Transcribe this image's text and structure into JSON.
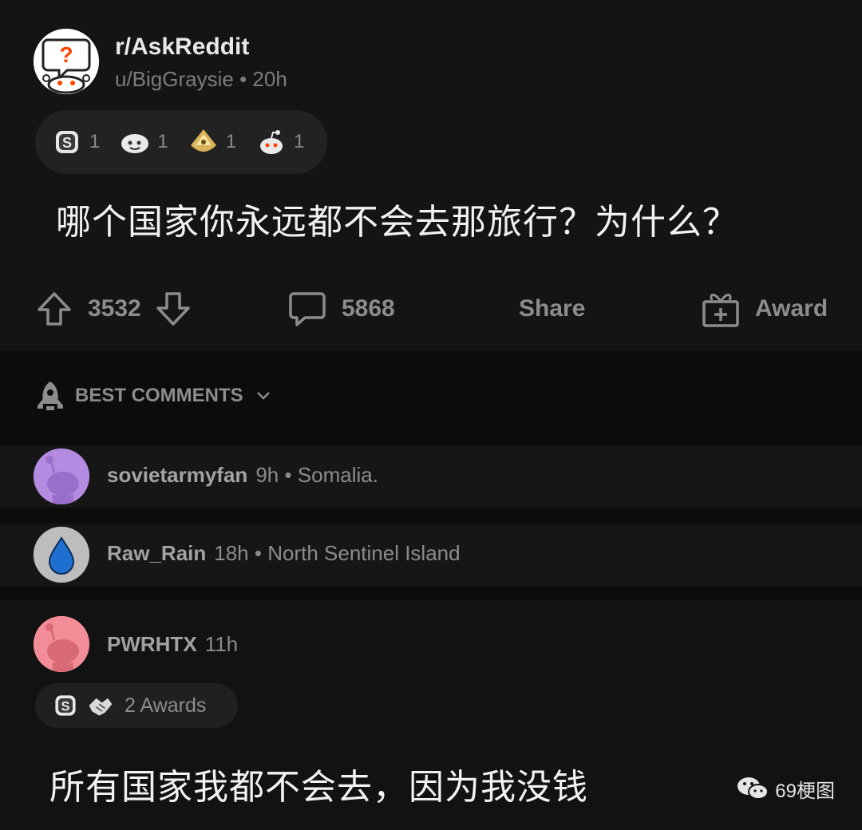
{
  "post": {
    "subreddit": "r/AskReddit",
    "author": "u/BigGraysie",
    "separator": " • ",
    "age": "20h",
    "awards": [
      {
        "icon": "silver-award-icon",
        "count": "1"
      },
      {
        "icon": "wholesome-award-icon",
        "count": "1"
      },
      {
        "icon": "helpful-award-icon",
        "count": "1"
      },
      {
        "icon": "snoo-award-icon",
        "count": "1"
      }
    ],
    "title": "哪个国家你永远都不会去那旅行？为什么？",
    "score": "3532",
    "comment_count": "5868",
    "share_label": "Share",
    "award_label": "Award"
  },
  "sort": {
    "label": "BEST COMMENTS"
  },
  "comments": [
    {
      "user": "sovietarmyfan",
      "age": "9h",
      "separator": " • ",
      "text": "Somalia."
    },
    {
      "user": "Raw_Rain",
      "age": "18h",
      "separator": " • ",
      "text": "North Sentinel Island"
    },
    {
      "user": "PWRHTX",
      "age": "11h",
      "awards_label": "2 Awards",
      "text": "所有国家我都不会去，因为我没钱"
    }
  ],
  "watermark": {
    "text": "69梗图"
  },
  "colors": {
    "background": "#0c0c0c",
    "card": "#141414",
    "muted_text": "#8c8c8c",
    "avatar_purple": "#b48be0",
    "avatar_pink": "#f28c96",
    "drop_blue": "#1f6fd1"
  }
}
